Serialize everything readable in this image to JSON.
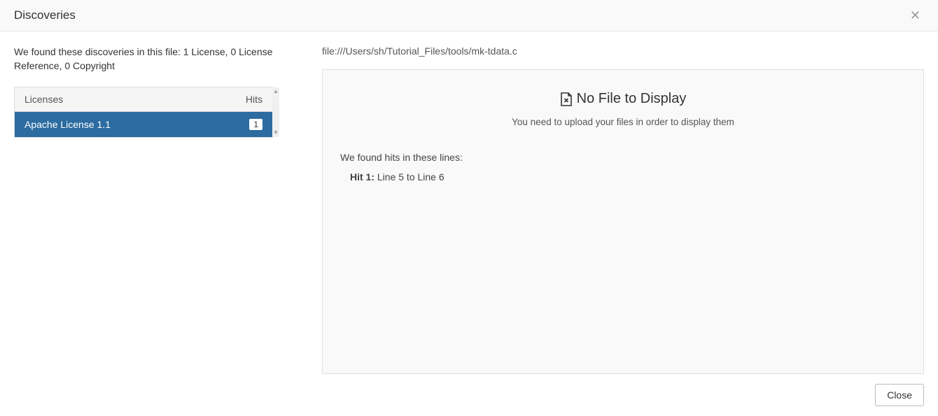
{
  "header": {
    "title": "Discoveries"
  },
  "left": {
    "summary": "We found these discoveries in this file: 1 License, 0 License Reference, 0 Copyright",
    "table": {
      "col_licenses": "Licenses",
      "col_hits": "Hits",
      "rows": [
        {
          "label": "Apache License 1.1",
          "hits": "1"
        }
      ]
    }
  },
  "right": {
    "file_path": "file:///Users/sh/Tutorial_Files/tools/mk-tdata.c",
    "no_file_title": "No File to Display",
    "no_file_sub": "You need to upload your files in order to display them",
    "hits_intro": "We found hits in these lines:",
    "hits": [
      {
        "label": "Hit 1:",
        "lines": "Line 5 to Line 6"
      }
    ]
  },
  "footer": {
    "close": "Close"
  }
}
